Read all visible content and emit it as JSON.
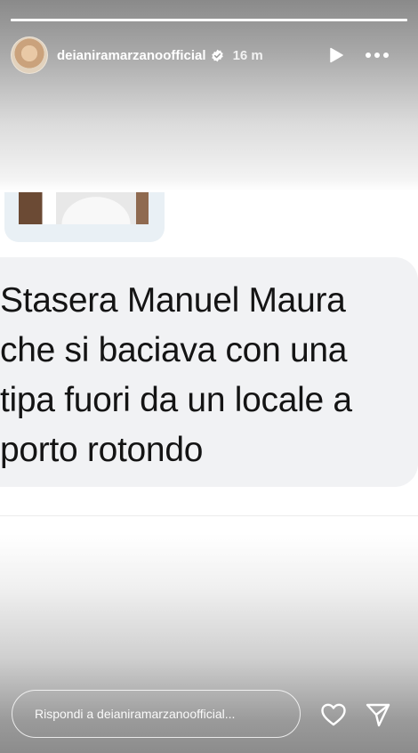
{
  "header": {
    "username": "deianiramarzanoofficial",
    "time": "16 m"
  },
  "message": {
    "lines": [
      "Stasera Manuel Maura",
      "che si baciava con una",
      "tipa fuori da un locale a",
      "porto rotondo"
    ]
  },
  "reply": {
    "placeholder": "Rispondi a deianiramarzanoofficial..."
  },
  "icons": {
    "verified": "verified-badge-icon",
    "play": "play-icon",
    "more": "more-horizontal-icon",
    "heart": "heart-icon",
    "send": "send-icon"
  }
}
